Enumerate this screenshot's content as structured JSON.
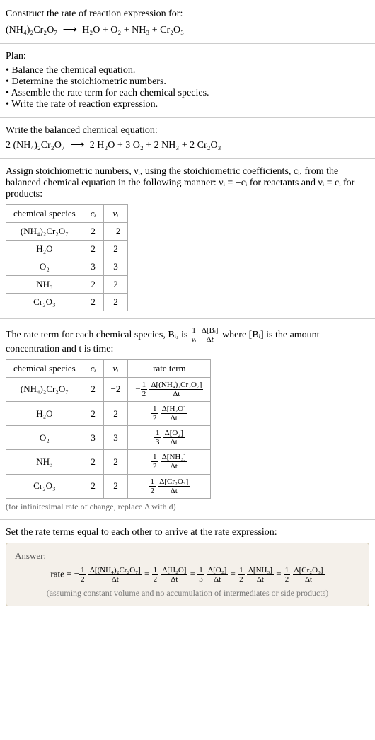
{
  "section1": {
    "prompt": "Construct the rate of reaction expression for:",
    "equation_lhs": "(NH₄)₂Cr₂O₇",
    "equation_rhs": "H₂O + O₂ + NH₃ + Cr₂O₃"
  },
  "section2": {
    "title": "Plan:",
    "items": [
      "Balance the chemical equation.",
      "Determine the stoichiometric numbers.",
      "Assemble the rate term for each chemical species.",
      "Write the rate of reaction expression."
    ]
  },
  "section3": {
    "title": "Write the balanced chemical equation:",
    "equation_lhs": "2 (NH₄)₂Cr₂O₇",
    "equation_rhs": "2 H₂O + 3 O₂ + 2 NH₃ + 2 Cr₂O₃"
  },
  "section4": {
    "intro_a": "Assign stoichiometric numbers, νᵢ, using the stoichiometric coefficients, cᵢ, from the balanced chemical equation in the following manner: νᵢ = −cᵢ for reactants and νᵢ = cᵢ for products:",
    "headers": [
      "chemical species",
      "cᵢ",
      "νᵢ"
    ],
    "rows": [
      {
        "sp": "(NH₄)₂Cr₂O₇",
        "c": "2",
        "v": "−2"
      },
      {
        "sp": "H₂O",
        "c": "2",
        "v": "2"
      },
      {
        "sp": "O₂",
        "c": "3",
        "v": "3"
      },
      {
        "sp": "NH₃",
        "c": "2",
        "v": "2"
      },
      {
        "sp": "Cr₂O₃",
        "c": "2",
        "v": "2"
      }
    ]
  },
  "section5": {
    "intro_pre": "The rate term for each chemical species, Bᵢ, is ",
    "intro_post": " where [Bᵢ] is the amount concentration and t is time:",
    "headers": [
      "chemical species",
      "cᵢ",
      "νᵢ",
      "rate term"
    ],
    "rows": [
      {
        "sp": "(NH₄)₂Cr₂O₇",
        "c": "2",
        "v": "−2",
        "sign": "−",
        "coef_num": "1",
        "coef_den": "2",
        "d_num": "Δ[(NH₄)₂Cr₂O₇]",
        "d_den": "Δt"
      },
      {
        "sp": "H₂O",
        "c": "2",
        "v": "2",
        "sign": "",
        "coef_num": "1",
        "coef_den": "2",
        "d_num": "Δ[H₂O]",
        "d_den": "Δt"
      },
      {
        "sp": "O₂",
        "c": "3",
        "v": "3",
        "sign": "",
        "coef_num": "1",
        "coef_den": "3",
        "d_num": "Δ[O₂]",
        "d_den": "Δt"
      },
      {
        "sp": "NH₃",
        "c": "2",
        "v": "2",
        "sign": "",
        "coef_num": "1",
        "coef_den": "2",
        "d_num": "Δ[NH₃]",
        "d_den": "Δt"
      },
      {
        "sp": "Cr₂O₃",
        "c": "2",
        "v": "2",
        "sign": "",
        "coef_num": "1",
        "coef_den": "2",
        "d_num": "Δ[Cr₂O₃]",
        "d_den": "Δt"
      }
    ],
    "note": "(for infinitesimal rate of change, replace Δ with d)"
  },
  "section6": {
    "title": "Set the rate terms equal to each other to arrive at the rate expression:",
    "answer_label": "Answer:",
    "rate_prefix": "rate = ",
    "terms": [
      {
        "sign": "−",
        "coef_num": "1",
        "coef_den": "2",
        "d_num": "Δ[(NH₄)₂Cr₂O₇]",
        "d_den": "Δt"
      },
      {
        "sign": "",
        "coef_num": "1",
        "coef_den": "2",
        "d_num": "Δ[H₂O]",
        "d_den": "Δt"
      },
      {
        "sign": "",
        "coef_num": "1",
        "coef_den": "3",
        "d_num": "Δ[O₂]",
        "d_den": "Δt"
      },
      {
        "sign": "",
        "coef_num": "1",
        "coef_den": "2",
        "d_num": "Δ[NH₃]",
        "d_den": "Δt"
      },
      {
        "sign": "",
        "coef_num": "1",
        "coef_den": "2",
        "d_num": "Δ[Cr₂O₃]",
        "d_den": "Δt"
      }
    ],
    "answer_note": "(assuming constant volume and no accumulation of intermediates or side products)"
  },
  "chart_data": {
    "type": "table",
    "title": "Stoichiometric numbers and rate terms",
    "tables": [
      {
        "headers": [
          "chemical species",
          "c_i",
          "ν_i"
        ],
        "rows": [
          [
            "(NH4)2Cr2O7",
            2,
            -2
          ],
          [
            "H2O",
            2,
            2
          ],
          [
            "O2",
            3,
            3
          ],
          [
            "NH3",
            2,
            2
          ],
          [
            "Cr2O3",
            2,
            2
          ]
        ]
      },
      {
        "headers": [
          "chemical species",
          "c_i",
          "ν_i",
          "rate term"
        ],
        "rows": [
          [
            "(NH4)2Cr2O7",
            2,
            -2,
            "-(1/2) Δ[(NH4)2Cr2O7]/Δt"
          ],
          [
            "H2O",
            2,
            2,
            "(1/2) Δ[H2O]/Δt"
          ],
          [
            "O2",
            3,
            3,
            "(1/3) Δ[O2]/Δt"
          ],
          [
            "NH3",
            2,
            2,
            "(1/2) Δ[NH3]/Δt"
          ],
          [
            "Cr2O3",
            2,
            2,
            "(1/2) Δ[Cr2O3]/Δt"
          ]
        ]
      }
    ],
    "rate_expression": "rate = -(1/2) Δ[(NH4)2Cr2O7]/Δt = (1/2) Δ[H2O]/Δt = (1/3) Δ[O2]/Δt = (1/2) Δ[NH3]/Δt = (1/2) Δ[Cr2O3]/Δt"
  }
}
